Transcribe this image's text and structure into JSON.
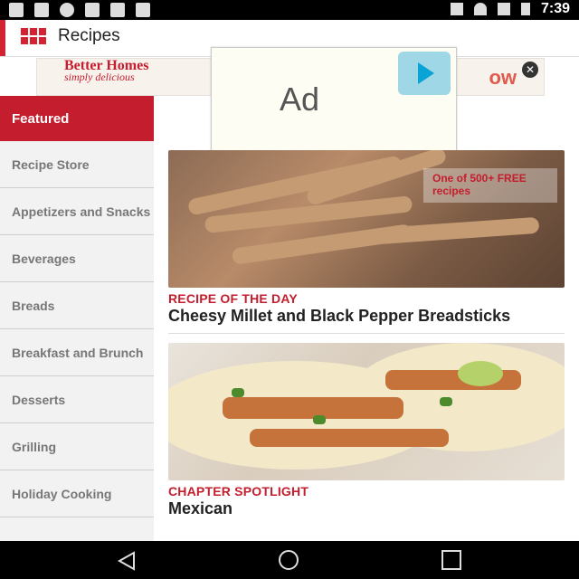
{
  "status_bar": {
    "left_icons": [
      "facebook-icon",
      "image-icon",
      "circle-icon",
      "lock-icon",
      "wifi-off-icon",
      "android-icon"
    ],
    "right_icons": [
      "bluetooth-icon",
      "wifi-icon",
      "signal-icon",
      "battery-icon"
    ],
    "time": "7:39"
  },
  "app_bar": {
    "title": "Recipes",
    "logo_icon": "bhg-logo-icon"
  },
  "banner_ad": {
    "brand_line1": "Better Homes",
    "brand_line2": "simply delicious",
    "cta_fragment": "ow",
    "close_icon": "close-icon"
  },
  "ad_overlay": {
    "label": "Ad",
    "logo_icon": "play-icon"
  },
  "sidebar": {
    "featured": "Featured",
    "items": [
      {
        "label": "Recipe Store"
      },
      {
        "label": "Appetizers and Snacks"
      },
      {
        "label": "Beverages"
      },
      {
        "label": "Breads"
      },
      {
        "label": "Breakfast and Brunch"
      },
      {
        "label": "Desserts"
      },
      {
        "label": "Grilling"
      },
      {
        "label": "Holiday Cooking"
      }
    ]
  },
  "cards": [
    {
      "promo": "One of 500+ FREE recipes",
      "kicker": "RECIPE OF THE DAY",
      "title": "Cheesy Millet and Black Pepper Breadsticks"
    },
    {
      "kicker": "CHAPTER SPOTLIGHT",
      "title": "Mexican"
    }
  ],
  "colors": {
    "accent": "#c41e2e",
    "sidebar_bg": "#f2f2f2"
  },
  "nav_bar": {
    "icons": [
      "back-icon",
      "home-icon",
      "recent-apps-icon"
    ]
  }
}
